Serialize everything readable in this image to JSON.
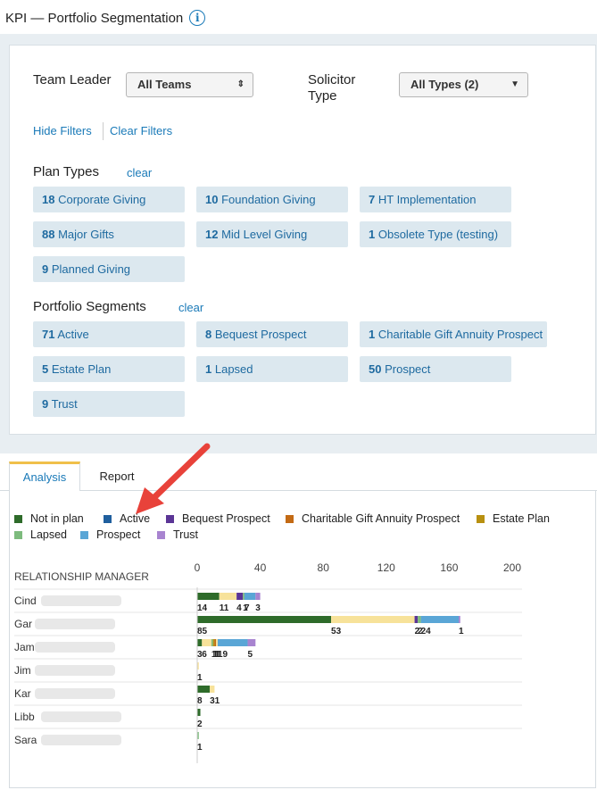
{
  "header": {
    "title": "KPI — Portfolio Segmentation",
    "info_icon": "info-icon"
  },
  "filters": {
    "team_leader_label": "Team Leader",
    "team_leader_value": "All Teams",
    "solicitor_type_label_1": "Solicitor",
    "solicitor_type_label_2": "Type",
    "solicitor_type_value": "All Types (2)",
    "hide_filters": "Hide Filters",
    "clear_filters": "Clear Filters",
    "plan_types_title": "Plan Types",
    "plan_types_clear": "clear",
    "plan_types": [
      {
        "count": "18",
        "label": "Corporate Giving"
      },
      {
        "count": "10",
        "label": "Foundation Giving"
      },
      {
        "count": "7",
        "label": "HT Implementation"
      },
      {
        "count": "88",
        "label": "Major Gifts"
      },
      {
        "count": "12",
        "label": "Mid Level Giving"
      },
      {
        "count": "1",
        "label": "Obsolete Type (testing)"
      },
      {
        "count": "9",
        "label": "Planned Giving"
      }
    ],
    "segments_title": "Portfolio Segments",
    "segments_clear": "clear",
    "segments": [
      {
        "count": "71",
        "label": "Active"
      },
      {
        "count": "8",
        "label": "Bequest Prospect"
      },
      {
        "count": "1",
        "label": "Charitable Gift Annuity Prospect"
      },
      {
        "count": "5",
        "label": "Estate Plan"
      },
      {
        "count": "1",
        "label": "Lapsed"
      },
      {
        "count": "50",
        "label": "Prospect"
      },
      {
        "count": "9",
        "label": "Trust"
      }
    ]
  },
  "tabs": {
    "analysis": "Analysis",
    "report": "Report"
  },
  "colors": {
    "Not in plan": "#2e6b2a",
    "Active": "#1f5f9e",
    "Bequest Prospect": "#5b3596",
    "Charitable Gift Annuity Prospect": "#c36a14",
    "Estate Plan": "#b89010",
    "Lapsed": "#7dbb7d",
    "Prospect": "#5aa6d6",
    "Trust": "#a884d0",
    "Major": "#f7e29a"
  },
  "chart_data": {
    "type": "bar",
    "orientation": "horizontal-stacked",
    "legend": [
      "Not in plan",
      "Active",
      "Bequest Prospect",
      "Charitable Gift Annuity Prospect",
      "Estate Plan",
      "Lapsed",
      "Prospect",
      "Trust"
    ],
    "ylabel": "RELATIONSHIP MANAGER",
    "xticks": [
      "0",
      "40",
      "80",
      "120",
      "160",
      "200"
    ],
    "xlim": [
      0,
      200
    ],
    "categories": [
      "Cind",
      "Gar",
      "Jam",
      "Jim",
      "Kar",
      "Libb",
      "Sara"
    ],
    "rows": [
      {
        "segments": [
          {
            "series": "Not in plan",
            "value": 14,
            "label": "14"
          },
          {
            "series": "Major",
            "value": 11,
            "label": "11"
          },
          {
            "series": "Bequest Prospect",
            "value": 4,
            "label": "4"
          },
          {
            "series": "Lapsed",
            "value": 1,
            "label": "1"
          },
          {
            "series": "Prospect",
            "value": 7,
            "label": "7"
          },
          {
            "series": "Trust",
            "value": 3,
            "label": "3"
          }
        ]
      },
      {
        "segments": [
          {
            "series": "Not in plan",
            "value": 85,
            "label": "85"
          },
          {
            "series": "Major",
            "value": 53,
            "label": "53"
          },
          {
            "series": "Bequest Prospect",
            "value": 2,
            "label": "2"
          },
          {
            "series": "Lapsed",
            "value": 2,
            "label": "2"
          },
          {
            "series": "Prospect",
            "value": 24,
            "label": "24"
          },
          {
            "series": "Trust",
            "value": 1,
            "label": "1"
          }
        ]
      },
      {
        "segments": [
          {
            "series": "Not in plan",
            "value": 3,
            "label": "3"
          },
          {
            "series": "Major",
            "value": 6,
            "label": "6"
          },
          {
            "series": "Lapsed",
            "value": 1,
            "label": "1"
          },
          {
            "series": "Estate Plan",
            "value": 1,
            "label": "1"
          },
          {
            "series": "Charitable Gift Annuity Prospect",
            "value": 1,
            "label": "1"
          },
          {
            "series": "Major",
            "value": 1,
            "label": "1"
          },
          {
            "series": "Prospect",
            "value": 19,
            "label": "19"
          },
          {
            "series": "Trust",
            "value": 5,
            "label": "5"
          }
        ]
      },
      {
        "segments": [
          {
            "series": "Major",
            "value": 1,
            "label": "1"
          }
        ]
      },
      {
        "segments": [
          {
            "series": "Not in plan",
            "value": 8,
            "label": "8"
          },
          {
            "series": "Major",
            "value": 3,
            "label": "31"
          }
        ]
      },
      {
        "segments": [
          {
            "series": "Not in plan",
            "value": 2,
            "label": "2"
          }
        ]
      },
      {
        "segments": [
          {
            "series": "Lapsed",
            "value": 1,
            "label": "1"
          }
        ]
      }
    ]
  }
}
